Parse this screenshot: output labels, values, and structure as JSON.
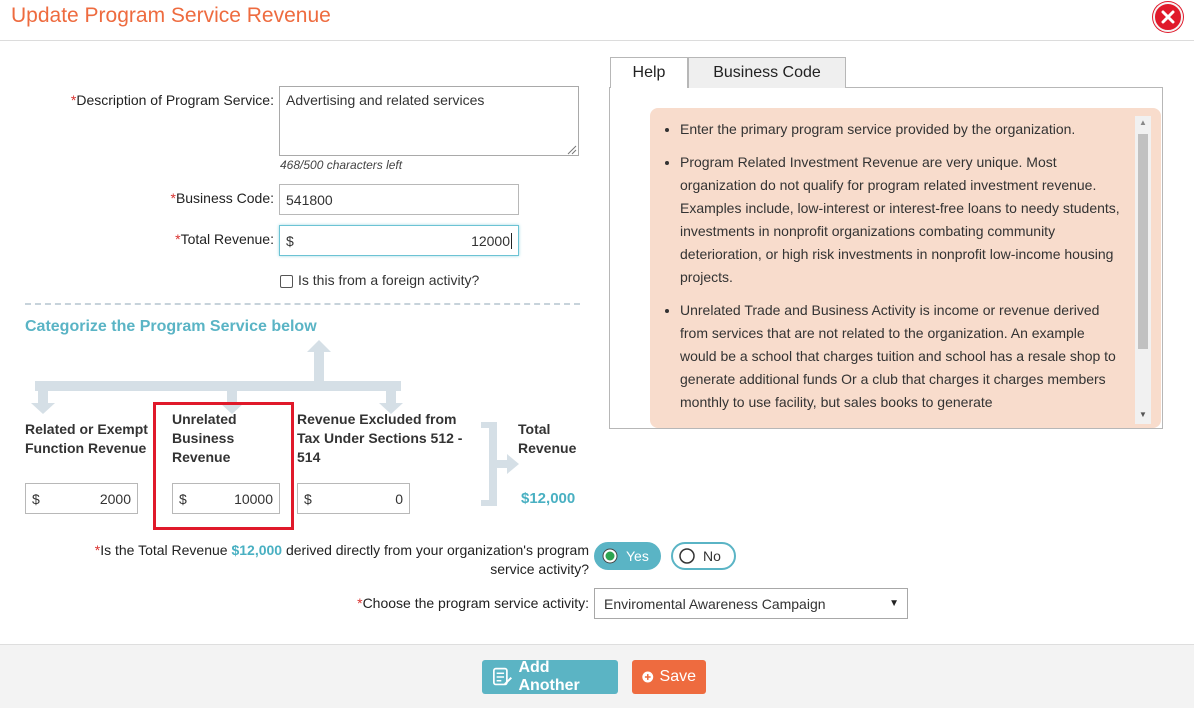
{
  "modal": {
    "title": "Update Program Service Revenue"
  },
  "form": {
    "required_mark": "*",
    "description_label": "Description of Program Service:",
    "description_value": "Advertising and related services",
    "chars_left": "468/500 characters left",
    "business_code_label": "Business Code:",
    "business_code_value": "541800",
    "total_revenue_label": "Total Revenue:",
    "currency": "$",
    "total_revenue_value": "12000",
    "foreign_label": "Is this from a foreign activity?",
    "foreign_checked": false
  },
  "categorize": {
    "title": "Categorize the Program Service below",
    "related_label": "Related or Exempt Function Revenue",
    "related_value": "2000",
    "unrelated_label": "Unrelated Business Revenue",
    "unrelated_value": "10000",
    "excluded_label": "Revenue Excluded from Tax Under Sections 512 - 514",
    "excluded_value": "0",
    "total_label": "Total Revenue",
    "total_value": "$12,000",
    "highlight_color": "#e0192a"
  },
  "question": {
    "text_before": "Is the Total Revenue",
    "amount": "$12,000",
    "text_after_line1": "derived directly from your organization's program",
    "text_after_line2": "service activity?",
    "yes_label": "Yes",
    "no_label": "No",
    "selected": "Yes"
  },
  "activity": {
    "label": "Choose the program service activity:",
    "selected": "Enviromental Awareness Campaign"
  },
  "tabs": [
    {
      "label": "Help",
      "active": false
    },
    {
      "label": "Business Code",
      "active": true
    }
  ],
  "help": {
    "items": [
      "Enter the primary program service provided by the organization.",
      "Program Related Investment Revenue are very unique. Most organization do not qualify for program related investment revenue. Examples include, low-interest or interest-free loans to needy students, investments in nonprofit organizations combating community deterioration, or high risk investments in nonprofit low-income housing projects.",
      "Unrelated Trade and Business Activity is income or revenue derived from services that are not related to the organization. An example would be a school that charges tuition and school has a resale shop to generate additional funds Or a club that charges it charges members monthly to use facility, but sales books to generate"
    ]
  },
  "footer": {
    "add_another_label": "Add Another",
    "save_label": "Save"
  },
  "colors": {
    "title": "#ee6b3f",
    "accent": "#5ab4c5",
    "save": "#ee6b3f",
    "add_another": "#5bb4c4",
    "help_bg": "#f8dccc"
  },
  "icons": [
    "close-icon",
    "list-edit-icon",
    "plus-circle-icon",
    "arrow-icon",
    "dropdown-caret-icon",
    "radio-icon",
    "checkbox-icon"
  ]
}
